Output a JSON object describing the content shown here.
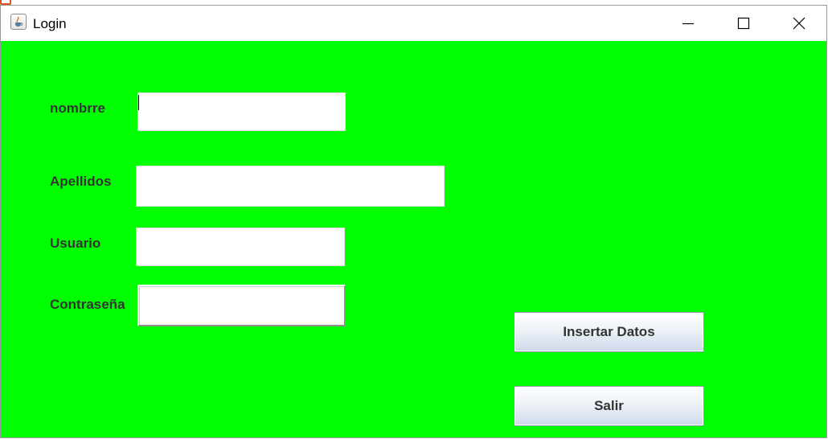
{
  "window": {
    "title": "Login",
    "background_color": "#00ff00"
  },
  "form": {
    "nombre_label": "nombrre",
    "nombre_value": "",
    "apellidos_label": "Apellidos",
    "apellidos_value": "",
    "usuario_label": "Usuario",
    "usuario_value": "",
    "contrasena_label": "Contraseña",
    "contrasena_value": ""
  },
  "buttons": {
    "insert_label": "Insertar Datos",
    "exit_label": "Salir"
  },
  "icons": {
    "app": "java-coffee-icon",
    "minimize": "minimize-icon",
    "maximize": "maximize-icon",
    "close": "close-icon"
  }
}
